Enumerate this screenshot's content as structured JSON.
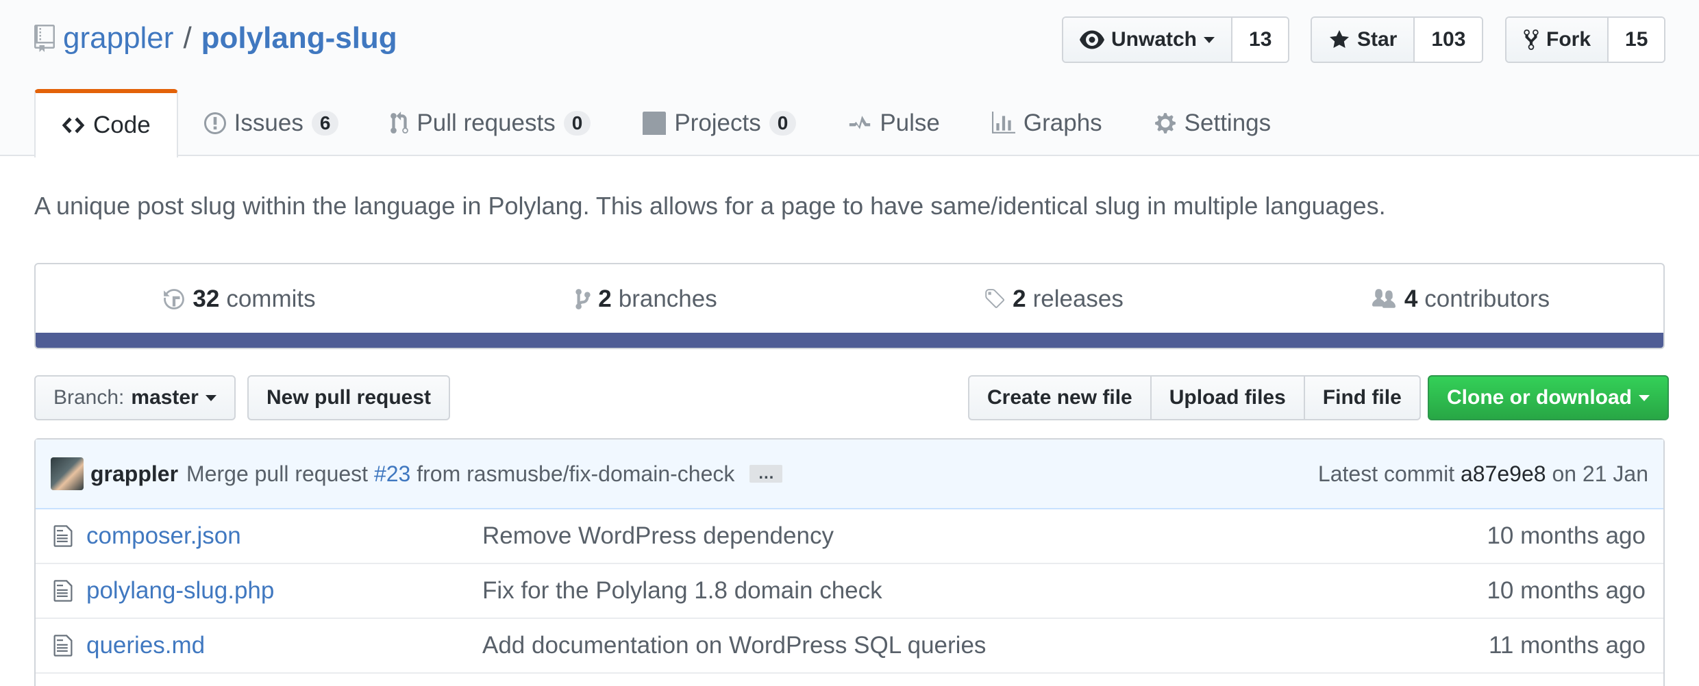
{
  "repo": {
    "owner": "grappler",
    "separator": "/",
    "name": "polylang-slug"
  },
  "actions": {
    "watch": {
      "label": "Unwatch",
      "count": "13",
      "icon": "eye-icon"
    },
    "star": {
      "label": "Star",
      "count": "103",
      "icon": "star-icon"
    },
    "fork": {
      "label": "Fork",
      "count": "15",
      "icon": "fork-icon"
    }
  },
  "tabs": [
    {
      "label": "Code",
      "icon": "code-icon",
      "count": ""
    },
    {
      "label": "Issues",
      "icon": "issue-icon",
      "count": "6"
    },
    {
      "label": "Pull requests",
      "icon": "pull-request-icon",
      "count": "0"
    },
    {
      "label": "Projects",
      "icon": "project-icon",
      "count": "0"
    },
    {
      "label": "Pulse",
      "icon": "pulse-icon",
      "count": ""
    },
    {
      "label": "Graphs",
      "icon": "graph-icon",
      "count": ""
    },
    {
      "label": "Settings",
      "icon": "gear-icon",
      "count": ""
    }
  ],
  "description": "A unique post slug within the language in Polylang. This allows for a page to have same/identical slug in multiple languages.",
  "summary": {
    "commits": {
      "num": "32",
      "label": "commits"
    },
    "branches": {
      "num": "2",
      "label": "branches"
    },
    "releases": {
      "num": "2",
      "label": "releases"
    },
    "contributors": {
      "num": "4",
      "label": "contributors"
    },
    "language_bar_color": "#4f5d95"
  },
  "file_nav": {
    "branch_label": "Branch:",
    "branch_name": "master",
    "new_pr": "New pull request",
    "create_file": "Create new file",
    "upload_files": "Upload files",
    "find_file": "Find file",
    "clone": "Clone or download"
  },
  "latest_commit": {
    "author": "grappler",
    "message_prefix": "Merge pull request",
    "pr_ref": "#23",
    "message_suffix": "from rasmusbe/fix-domain-check",
    "ellipsis": "…",
    "latest_label": "Latest commit",
    "sha": "a87e9e8",
    "date": "on 21 Jan"
  },
  "files": [
    {
      "name": "composer.json",
      "message": "Remove WordPress dependency",
      "age": "10 months ago"
    },
    {
      "name": "polylang-slug.php",
      "message": "Fix for the Polylang 1.8 domain check",
      "age": "10 months ago"
    },
    {
      "name": "queries.md",
      "message": "Add documentation on WordPress SQL queries",
      "age": "11 months ago"
    }
  ],
  "colors": {
    "link": "#4078c0",
    "accent_tab": "#e36209",
    "clone_green": "#28a745"
  }
}
